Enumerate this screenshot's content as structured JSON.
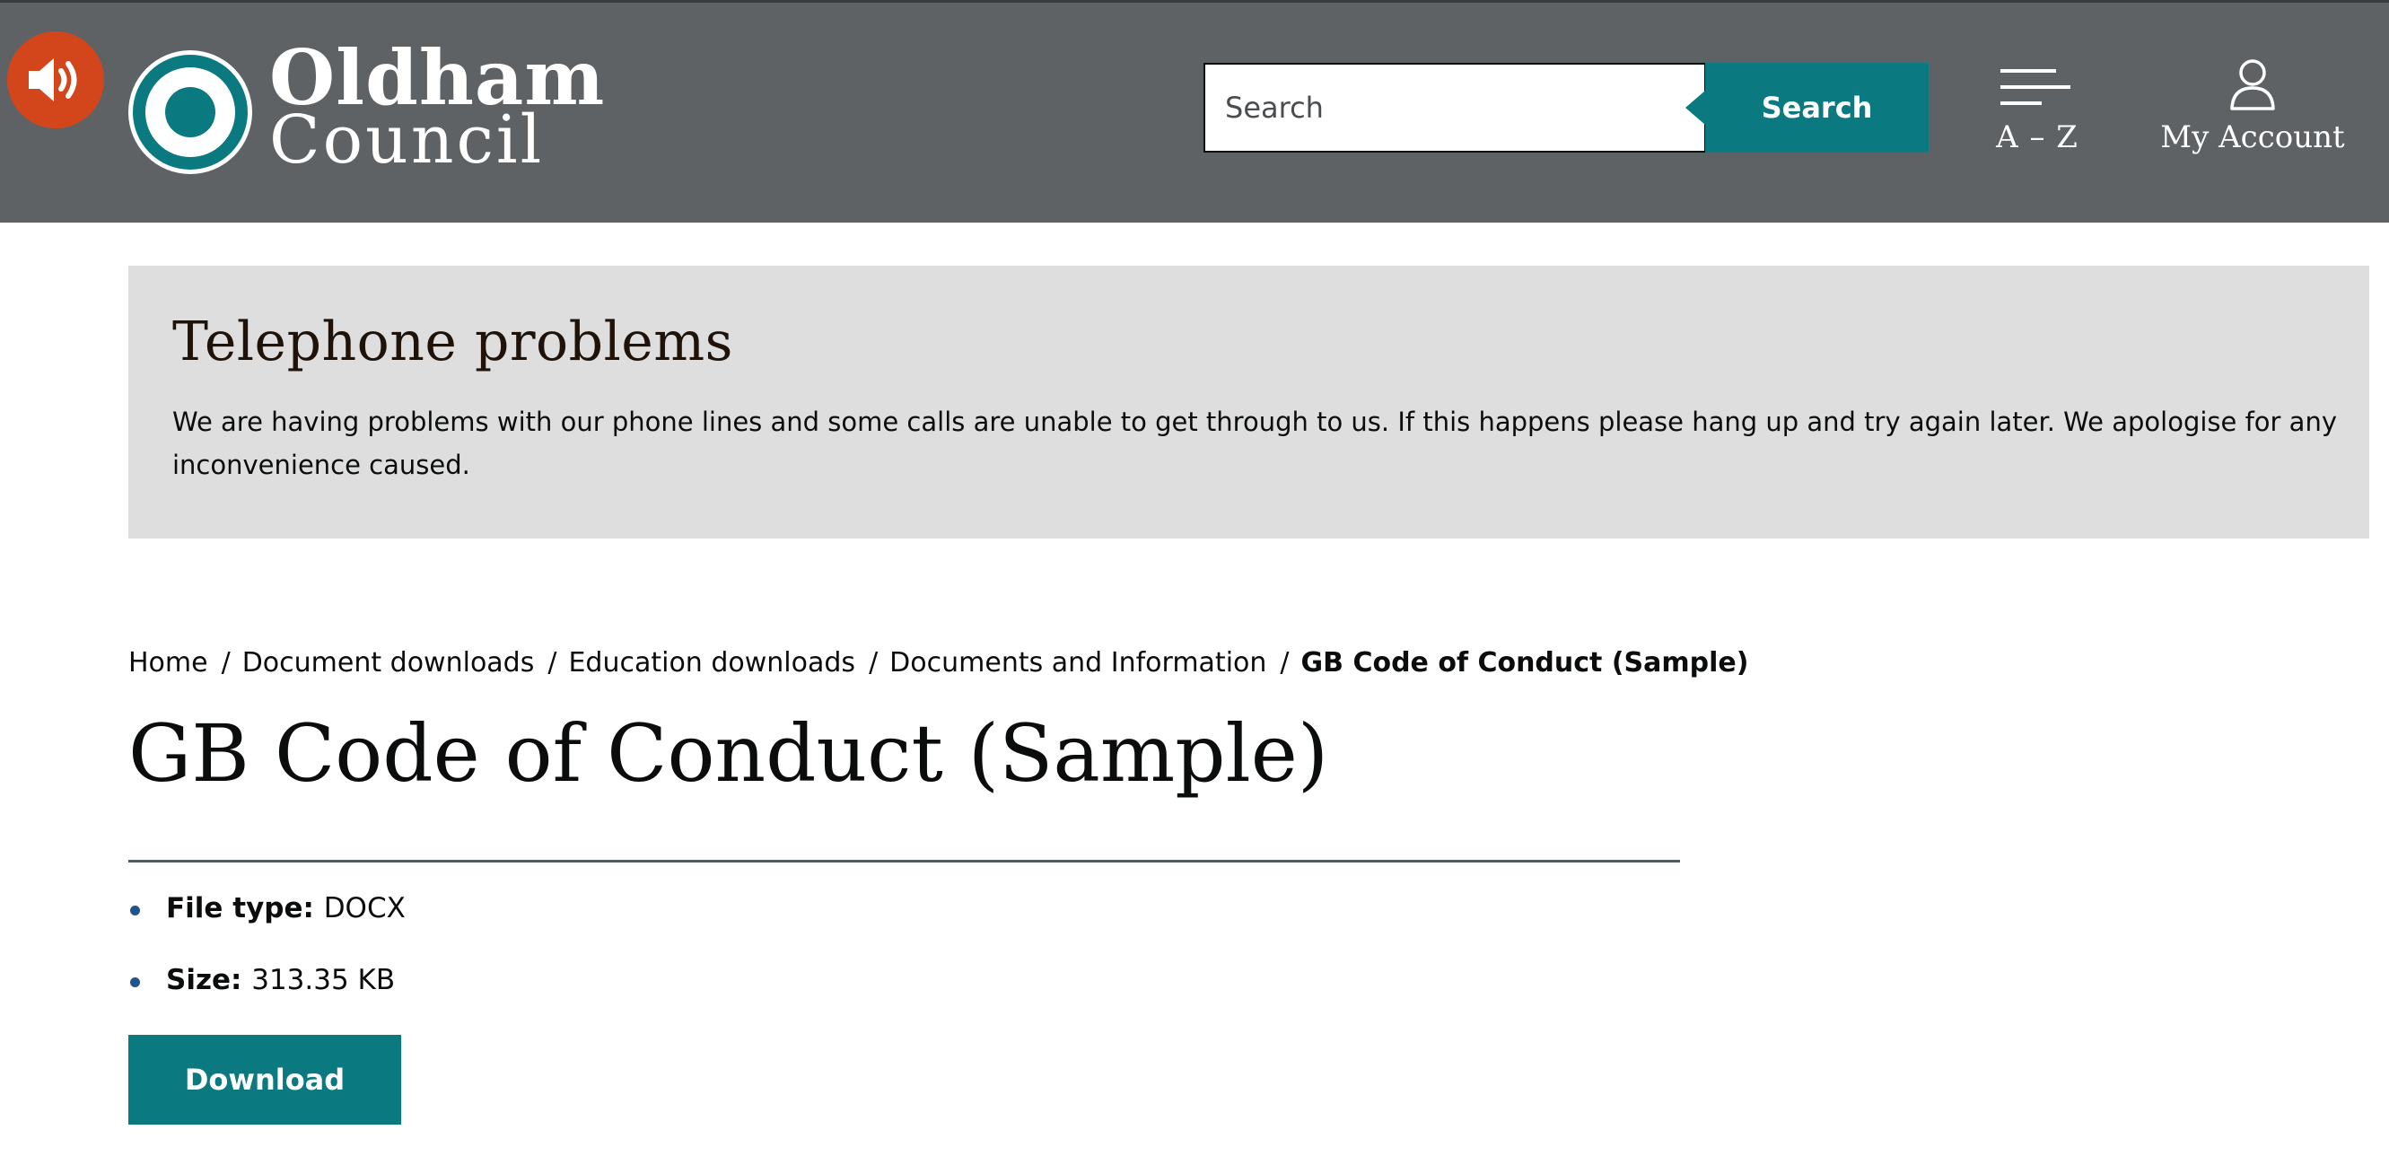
{
  "colors": {
    "header_bg": "#5f6265",
    "accent": "#0b7a80",
    "audio_button": "#d3461b",
    "alert_bg": "#dedede",
    "bullet": "#1d5590"
  },
  "header": {
    "audio_icon": "speaker-volume-icon",
    "logo": {
      "line1": "Oldham",
      "line2": "Council"
    },
    "search": {
      "placeholder": "Search",
      "button_label": "Search"
    },
    "az": {
      "icon": "menu-lines-icon",
      "label": "A – Z"
    },
    "account": {
      "icon": "user-icon",
      "label": "My Account"
    }
  },
  "alert": {
    "title": "Telephone problems",
    "text": "We are having problems with our phone lines and some calls are unable to get through to us. If this happens please hang up and try again later. We apologise for any inconvenience caused."
  },
  "breadcrumb": {
    "items": [
      "Home",
      "Document downloads",
      "Education downloads",
      "Documents and Information"
    ],
    "separator": "/",
    "current": "GB Code of Conduct (Sample)"
  },
  "page": {
    "title": "GB Code of Conduct (Sample)",
    "file_type_label": "File type:",
    "file_type_value": "DOCX",
    "size_label": "Size:",
    "size_value": "313.35 KB",
    "download_label": "Download"
  }
}
